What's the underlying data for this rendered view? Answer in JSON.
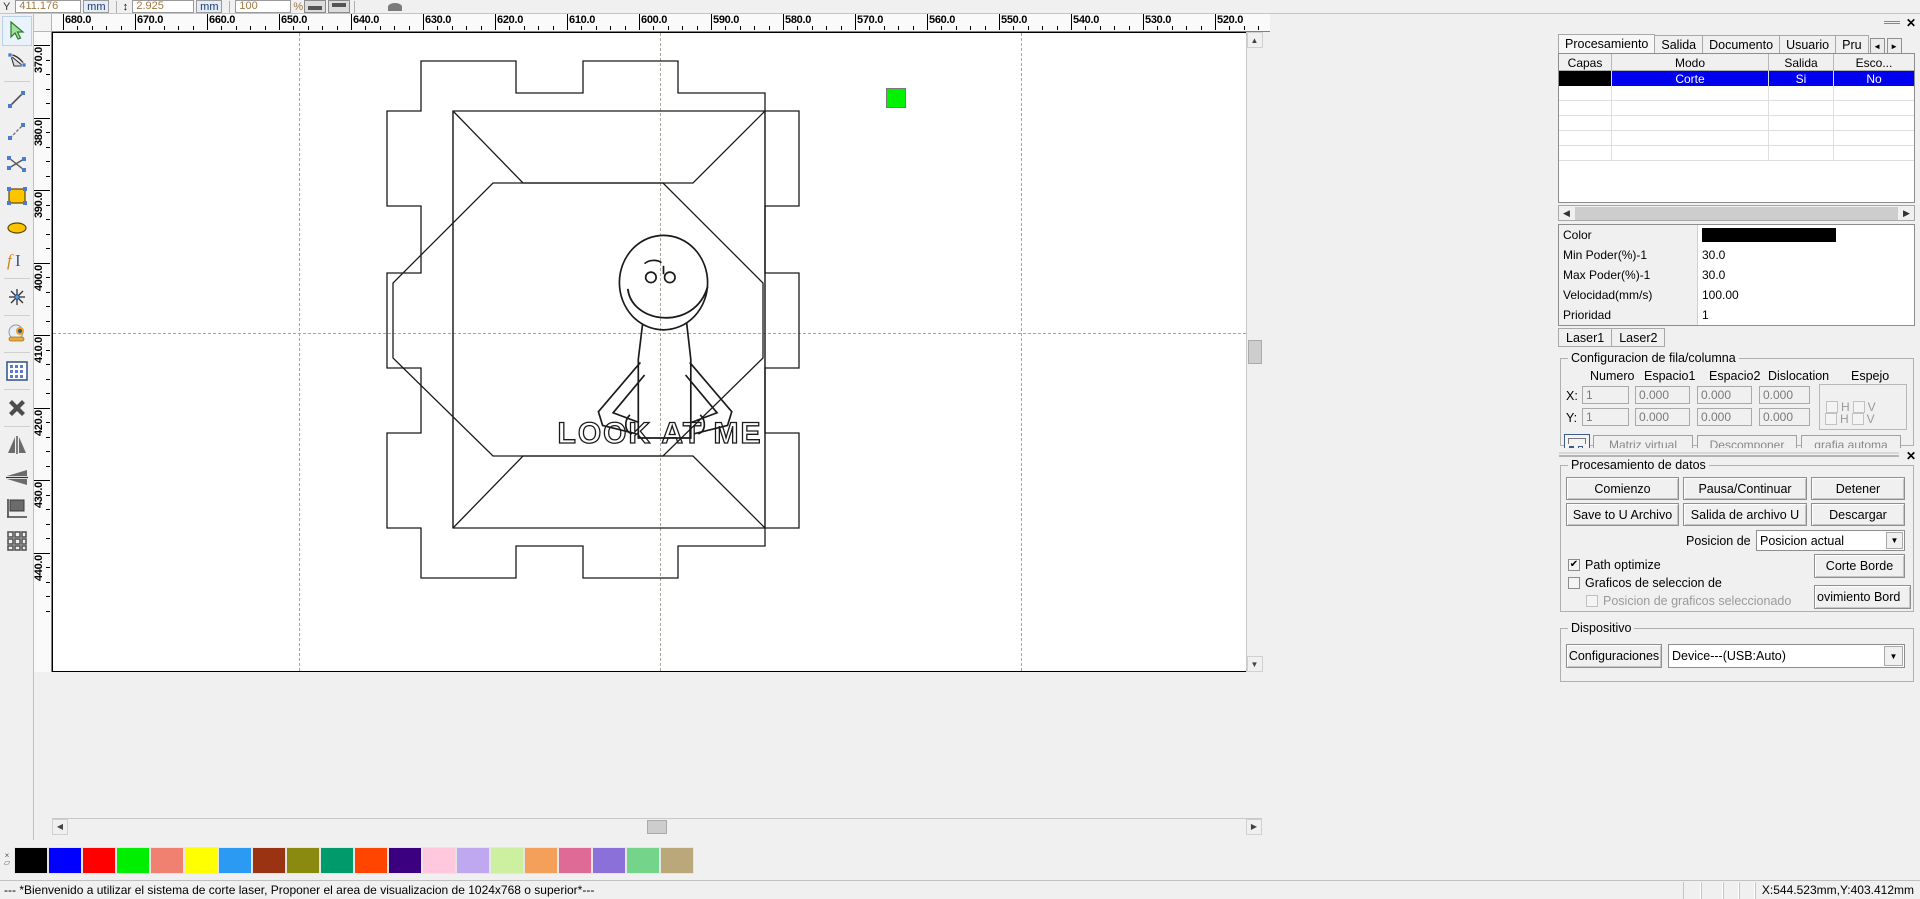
{
  "toolbar": {
    "y_label": "Y",
    "y_value": "411.176",
    "y_unit": "mm",
    "h_value": "2.925",
    "h_unit": "mm",
    "scale_value": "100",
    "scale_unit": "%"
  },
  "left_tools": [
    {
      "name": "select-arrow-tool",
      "label": "Seleccionar"
    },
    {
      "name": "node-edit-tool",
      "label": "Editar nodos"
    },
    {
      "name": "line-tool",
      "label": "Linea"
    },
    {
      "name": "polyline-tool",
      "label": "Polilinea"
    },
    {
      "name": "curve-tool",
      "label": "Curva"
    },
    {
      "name": "rectangle-tool",
      "label": "Rectangulo"
    },
    {
      "name": "ellipse-tool",
      "label": "Elipse"
    },
    {
      "name": "text-tool",
      "label": "Texto"
    },
    {
      "name": "origin-point-tool",
      "label": "Punto de origen"
    },
    {
      "name": "camera-tool",
      "label": "Camara"
    },
    {
      "name": "array-tool",
      "label": "Matriz"
    },
    {
      "name": "delete-tool",
      "label": "Borrar"
    },
    {
      "name": "mirror-horizontal-tool",
      "label": "Espejo horizontal"
    },
    {
      "name": "mirror-vertical-tool",
      "label": "Espejo vertical"
    },
    {
      "name": "align-tool",
      "label": "Alinear"
    },
    {
      "name": "grid-array-tool",
      "label": "Matriz de rejilla"
    }
  ],
  "rulers": {
    "horizontal_labels": [
      "680.0",
      "670.0",
      "660.0",
      "650.0",
      "640.0",
      "630.0",
      "620.0",
      "610.0",
      "600.0",
      "590.0",
      "580.0",
      "570.0",
      "560.0",
      "550.0",
      "540.0",
      "530.0",
      "520.0"
    ],
    "vertical_labels": [
      "370.0",
      "380.0",
      "390.0",
      "400.0",
      "410.0",
      "420.0",
      "430.0",
      "440.0"
    ],
    "unit": "mm"
  },
  "canvas": {
    "artwork_text": "LOOK AT ME",
    "selection_marker_color": "#00f200"
  },
  "palette": {
    "colors": [
      "#000000",
      "#0000ff",
      "#ff0000",
      "#00ee00",
      "#f08070",
      "#ffff00",
      "#2b9af3",
      "#993311",
      "#8a8a11",
      "#019a6a",
      "#ff4500",
      "#3b0080",
      "#ffc8dd",
      "#c0a8f0",
      "#ccf0a0",
      "#f5a05a",
      "#e06a96",
      "#8a70d8",
      "#74d48a",
      "#bba87a"
    ]
  },
  "status": {
    "message": "--- *Bienvenido a utilizar el sistema de corte laser, Proponer el area de visualizacion de 1024x768 o superior*---",
    "coordinates": "X:544.523mm,Y:403.412mm"
  },
  "right_panel": {
    "tabs": [
      {
        "label": "Procesamiento",
        "active": true
      },
      {
        "label": "Salida",
        "active": false
      },
      {
        "label": "Documento",
        "active": false
      },
      {
        "label": "Usuario",
        "active": false
      },
      {
        "label": "Pru",
        "active": false
      }
    ],
    "tab_nav_prev": "◄",
    "tab_nav_next": "►",
    "layer_table": {
      "headers": [
        "Capas",
        "Modo",
        "Salida",
        "Esco..."
      ],
      "rows": [
        {
          "color": "#000000",
          "modo": "Corte",
          "salida": "Si",
          "escolar": "No",
          "selected": true
        }
      ],
      "empty_rows": 5
    },
    "properties": [
      {
        "key": "Color",
        "value": "",
        "color": "#000000"
      },
      {
        "key": "Min Poder(%)-1",
        "value": "30.0"
      },
      {
        "key": "Max Poder(%)-1",
        "value": "30.0"
      },
      {
        "key": "Velocidad(mm/s)",
        "value": "100.00"
      },
      {
        "key": "Prioridad",
        "value": "1"
      }
    ],
    "laser_tabs": [
      {
        "label": "Laser1"
      },
      {
        "label": "Laser2"
      }
    ],
    "row_column": {
      "title": "Configuracion de fila/columna",
      "headers": [
        "Numero",
        "Espacio1",
        "Espacio2",
        "Dislocation",
        "Espejo"
      ],
      "rows": [
        {
          "axis": "X:",
          "numero": "1",
          "espacio1": "0.000",
          "espacio2": "0.000",
          "dislocation": "0.000",
          "mirror_h": "H",
          "mirror_v": "V"
        },
        {
          "axis": "Y:",
          "numero": "1",
          "espacio1": "0.000",
          "espacio2": "0.000",
          "dislocation": "0.000",
          "mirror_h": "H",
          "mirror_v": "V"
        }
      ],
      "buttons": [
        "Matriz virtual",
        "Descomponer",
        "grafia automa"
      ]
    }
  },
  "processing_panel": {
    "title": "Procesamiento de datos",
    "buttons_row1": [
      "Comienzo",
      "Pausa/Continuar",
      "Detener"
    ],
    "buttons_row2": [
      "Save to U Archivo",
      "Salida de archivo U",
      "Descargar"
    ],
    "position_label": "Posicion de",
    "position_value": "Posicion actual",
    "path_optimize": {
      "label": "Path optimize",
      "checked": true
    },
    "select_graphics": {
      "label": "Graficos de seleccion de",
      "checked": false
    },
    "position_graphics": {
      "label": "Posicion de graficos seleccionado",
      "checked": false
    },
    "edge_cut_button": "Corte Borde",
    "edge_move_button": "ovimiento Bord",
    "device": {
      "title": "Dispositivo",
      "settings_button": "Configuraciones",
      "value": "Device---(USB:Auto)"
    }
  }
}
